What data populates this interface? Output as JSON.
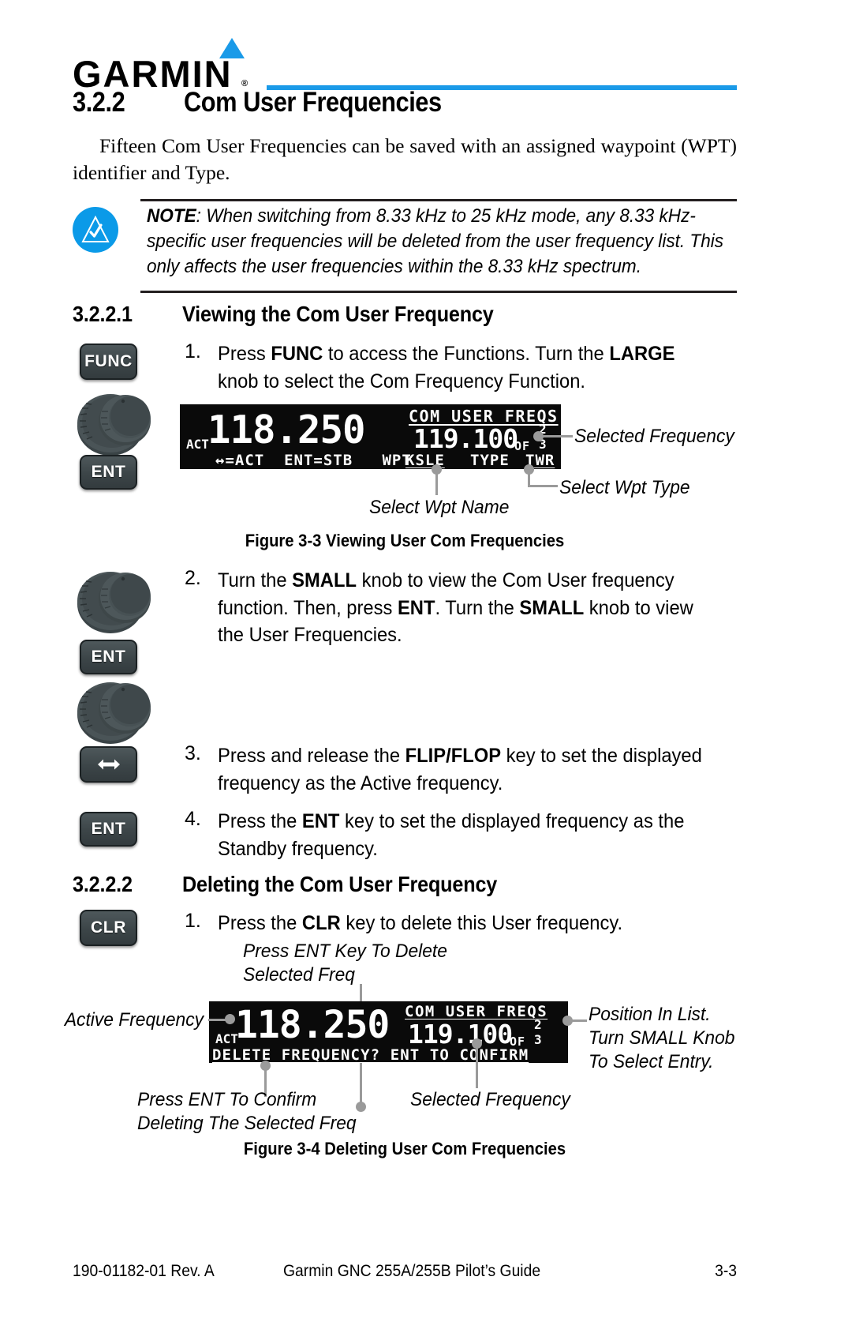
{
  "header": {
    "logo_text": "GARMIN",
    "logo_registered": "®",
    "accent_color": "#1a9ae8"
  },
  "section": {
    "number": "3.2.2",
    "title": "Com User Frequencies",
    "intro": "Fifteen Com User Frequencies can be saved with an assigned waypoint (WPT) identifier and Type."
  },
  "note": {
    "label": "NOTE",
    "body": ":  When switching from 8.33 kHz to 25 kHz mode, any 8.33 kHz-specific user frequencies will be deleted from the user frequency list. This only affects the user frequencies within the 8.33 kHz spectrum.",
    "icon_color": "#0b9ae8",
    "icon_name": "note-triangle-check-icon"
  },
  "subsection_1": {
    "number": "3.2.2.1",
    "title": "Viewing the Com User Frequency",
    "steps": [
      {
        "num": "1.",
        "html": "Press <b>FUNC</b> to access the Functions. Turn the <b>LARGE</b> knob to select the Com Frequency Function."
      },
      {
        "num": "2.",
        "html": "Turn the <b>SMALL</b> knob to view the Com User frequency function. Then, press <b>ENT</b>. Turn the <b>SMALL</b> knob to view the User Frequencies."
      },
      {
        "num": "3.",
        "html": "Press and release the <b>FLIP/FLOP</b> key to set the displayed frequency as the Active frequency."
      },
      {
        "num": "4.",
        "html": "Press the <b>ENT</b> key to set the displayed frequency as the Standby frequency."
      }
    ]
  },
  "subsection_2": {
    "number": "3.2.2.2",
    "title": "Deleting the Com User Frequency",
    "steps": [
      {
        "num": "1.",
        "html": "Press the <b>CLR</b> key to delete this User frequency."
      }
    ]
  },
  "keys": {
    "func": "FUNC",
    "ent": "ENT",
    "clr": "CLR",
    "flipflop_glyph": "↔",
    "knob_name": "dual-concentric-knob"
  },
  "display_1": {
    "active_label": "ACT",
    "active_freq": "118.250",
    "title": "COM USER FREQS",
    "selected_freq": "119.100",
    "of_label": "OF",
    "position_current": "2",
    "position_total": "3",
    "status_line": "↔=ACT  ENT=STB   WPT",
    "wpt_value": "KSLE",
    "type_label": "TYPE",
    "type_value": "TWR"
  },
  "figure_1": {
    "caption": "Figure 3-3  Viewing User Com Frequencies",
    "callouts": {
      "selected_frequency": "Selected Frequency",
      "select_wpt_type": "Select Wpt Type",
      "select_wpt_name": "Select Wpt Name"
    }
  },
  "display_2": {
    "active_label": "ACT",
    "active_freq": "118.250",
    "title": "COM USER FREQS",
    "selected_freq": "119.100",
    "of_label": "OF",
    "position_current": "2",
    "position_total": "3",
    "prompt_line": "DELETE FREQUENCY? ENT TO CONFIRM"
  },
  "figure_2": {
    "caption": "Figure 3-4  Deleting User Com Frequencies",
    "callouts": {
      "press_ent_delete": "Press ENT Key To Delete\nSelected Freq",
      "active_frequency": "Active Frequency",
      "position_in_list": "Position In List.\nTurn SMALL Knob\nTo Select Entry.",
      "press_ent_confirm": "Press ENT To Confirm\nDeleting The Selected Freq",
      "selected_frequency": "Selected Frequency"
    }
  },
  "footer": {
    "left": "190-01182-01  Rev. A",
    "center": "Garmin GNC 255A/255B Pilot’s Guide",
    "right": "3-3"
  }
}
